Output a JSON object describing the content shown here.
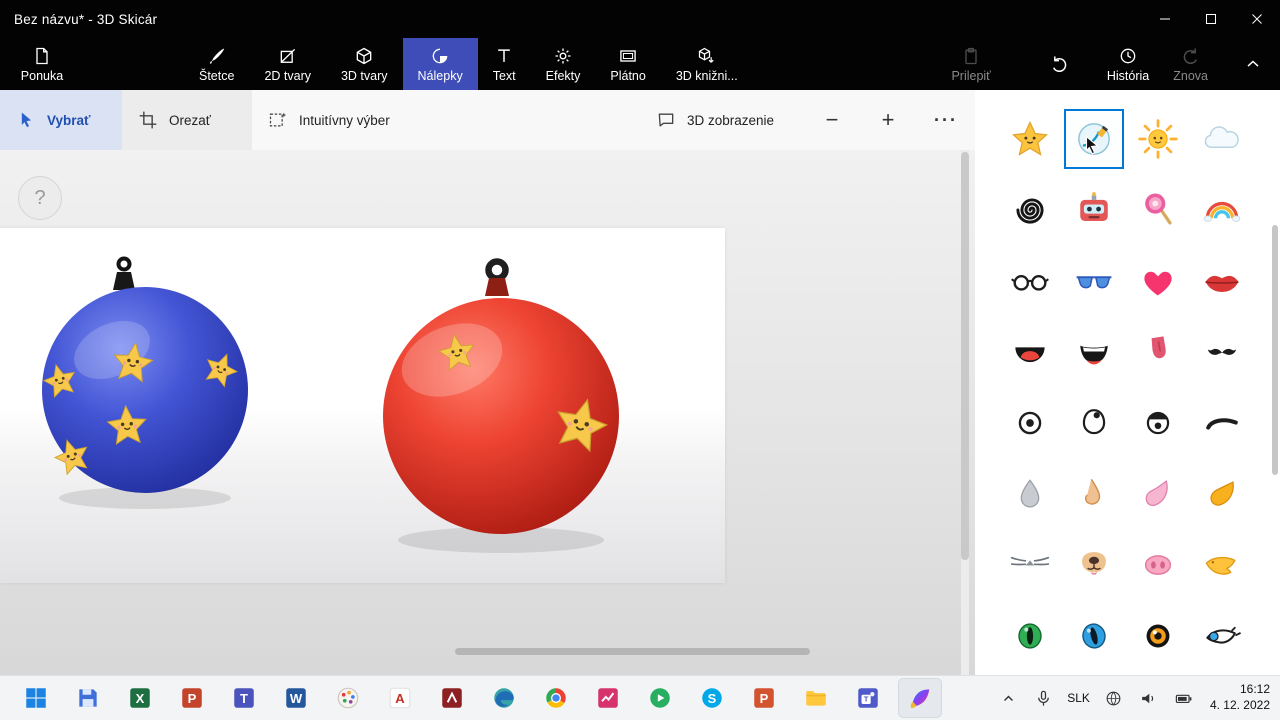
{
  "window": {
    "title": "Bez názvu* - 3D Skicár"
  },
  "ribbon": {
    "menu": {
      "label": "Ponuka",
      "icon": "document"
    },
    "tabs": [
      {
        "name": "tab-brushes",
        "label": "Štetce",
        "icon": "brush"
      },
      {
        "name": "tab-2d-shapes",
        "label": "2D tvary",
        "icon": "shapes2d"
      },
      {
        "name": "tab-3d-shapes",
        "label": "3D tvary",
        "icon": "cube"
      },
      {
        "name": "tab-stickers",
        "label": "Nálepky",
        "icon": "sticker",
        "selected": true
      },
      {
        "name": "tab-text",
        "label": "Text",
        "icon": "text"
      },
      {
        "name": "tab-effects",
        "label": "Efekty",
        "icon": "effects"
      },
      {
        "name": "tab-canvas",
        "label": "Plátno",
        "icon": "canvas"
      },
      {
        "name": "tab-3d-library",
        "label": "3D knižni...",
        "icon": "library"
      }
    ],
    "right": [
      {
        "name": "paste-button",
        "label": "Prilepiť",
        "icon": "paste",
        "disabled": true,
        "cls": "paste"
      },
      {
        "name": "undo-button",
        "label": "",
        "icon": "undo",
        "disabled": false,
        "cls": "undo"
      },
      {
        "name": "history-button",
        "label": "História",
        "icon": "history",
        "disabled": false,
        "cls": ""
      },
      {
        "name": "redo-button",
        "label": "Znova",
        "icon": "redo",
        "disabled": true,
        "cls": ""
      }
    ]
  },
  "toolbar": {
    "select_label": "Vybrať",
    "crop_label": "Orezať",
    "magic_label": "Intuitívny výber",
    "view3d_label": "3D zobrazenie",
    "zoom_out": "−",
    "zoom_in": "+",
    "more": "···"
  },
  "canvas": {
    "help_label": "?"
  },
  "accent_colors": {
    "ribbon_selected": "#3f4db8",
    "selection_border": "#0078d7"
  },
  "stickers": [
    {
      "name": "star-sticker",
      "glyph": "star"
    },
    {
      "name": "doodle-sticker",
      "glyph": "doodle",
      "selected": true
    },
    {
      "name": "sun-sticker",
      "glyph": "sun"
    },
    {
      "name": "cloud-sticker",
      "glyph": "cloud"
    },
    {
      "name": "spiral-sticker",
      "glyph": "spiral"
    },
    {
      "name": "robot-sticker",
      "glyph": "robot"
    },
    {
      "name": "lollipop-sticker",
      "glyph": "lollipop"
    },
    {
      "name": "rainbow-sticker",
      "glyph": "rainbow"
    },
    {
      "name": "glasses-sticker",
      "glyph": "glasses"
    },
    {
      "name": "sunglasses-sticker",
      "glyph": "sunglasses"
    },
    {
      "name": "heart-sticker",
      "glyph": "heart"
    },
    {
      "name": "lips-sticker",
      "glyph": "lips"
    },
    {
      "name": "open-mouth-sticker",
      "glyph": "mouthopen"
    },
    {
      "name": "laughing-mouth-sticker",
      "glyph": "mouthlaugh"
    },
    {
      "name": "tongue-sticker",
      "glyph": "tongue"
    },
    {
      "name": "mustache-sticker",
      "glyph": "mustache"
    },
    {
      "name": "eye-sticker",
      "glyph": "eyedot"
    },
    {
      "name": "looking-eye-sticker",
      "glyph": "eyelook"
    },
    {
      "name": "wide-eye-sticker",
      "glyph": "eyewide"
    },
    {
      "name": "eyebrow-sticker",
      "glyph": "eyebrow"
    },
    {
      "name": "gray-nose-sticker",
      "glyph": "nosegray"
    },
    {
      "name": "side-nose-sticker",
      "glyph": "noseside"
    },
    {
      "name": "petal-nose-sticker",
      "glyph": "petal"
    },
    {
      "name": "orange-beak-sticker",
      "glyph": "beak"
    },
    {
      "name": "cat-whiskers-sticker",
      "glyph": "whiskers"
    },
    {
      "name": "dog-nose-sticker",
      "glyph": "dognose"
    },
    {
      "name": "pig-snout-sticker",
      "glyph": "pigsnout"
    },
    {
      "name": "duck-beak-sticker",
      "glyph": "duckbeak"
    },
    {
      "name": "green-cat-eye-sticker",
      "glyph": "cateyegreen"
    },
    {
      "name": "blue-cat-eye-sticker",
      "glyph": "cateyeblue"
    },
    {
      "name": "orange-eye-sticker",
      "glyph": "eyeorange"
    },
    {
      "name": "blue-eye-sticker",
      "glyph": "eyeside"
    }
  ],
  "taskbar": {
    "items": [
      {
        "name": "start-button",
        "glyph": "win"
      },
      {
        "name": "taskbar-floppy-app",
        "glyph": "floppy"
      },
      {
        "name": "taskbar-excel",
        "glyph": "excel"
      },
      {
        "name": "taskbar-powerpoint",
        "glyph": "ppt"
      },
      {
        "name": "taskbar-teams",
        "glyph": "teams"
      },
      {
        "name": "taskbar-word",
        "glyph": "word"
      },
      {
        "name": "taskbar-paint",
        "glyph": "palette"
      },
      {
        "name": "taskbar-acrobat",
        "glyph": "acrobat"
      },
      {
        "name": "taskbar-maroon-app",
        "glyph": "maroon"
      },
      {
        "name": "taskbar-edge",
        "glyph": "edge"
      },
      {
        "name": "taskbar-chrome",
        "glyph": "chrome"
      },
      {
        "name": "taskbar-chart-app",
        "glyph": "chart"
      },
      {
        "name": "taskbar-media-app",
        "glyph": "play"
      },
      {
        "name": "taskbar-skype",
        "glyph": "skype"
      },
      {
        "name": "taskbar-powerpoint-2",
        "glyph": "ppt2"
      },
      {
        "name": "taskbar-folder",
        "glyph": "folder"
      },
      {
        "name": "taskbar-teams-2",
        "glyph": "teams2"
      },
      {
        "name": "taskbar-paint3d",
        "glyph": "paint3d",
        "active": true
      }
    ],
    "tray": {
      "lang": "SLK",
      "time": "16:12",
      "date": "4. 12. 2022"
    }
  }
}
